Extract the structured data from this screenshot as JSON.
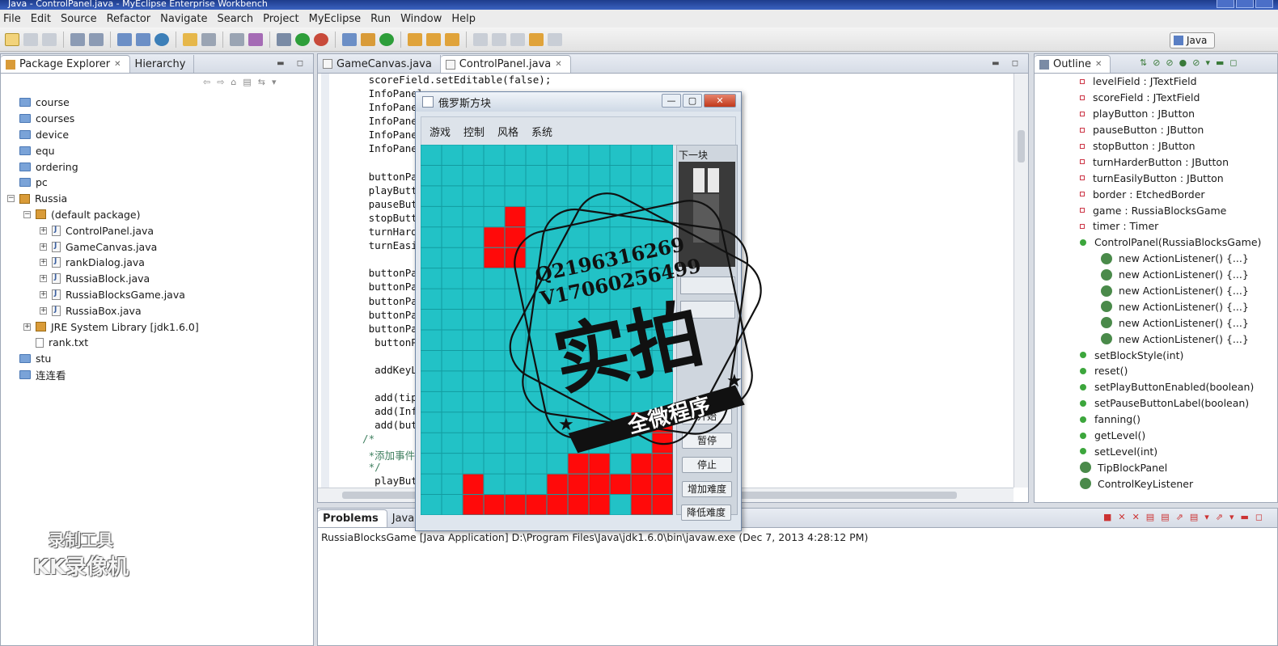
{
  "window": {
    "title": "Java - ControlPanel.java - MyEclipse Enterprise Workbench"
  },
  "menu": [
    "File",
    "Edit",
    "Source",
    "Refactor",
    "Navigate",
    "Search",
    "Project",
    "MyEclipse",
    "Run",
    "Window",
    "Help"
  ],
  "perspective": {
    "label": "Java"
  },
  "explorer": {
    "tabs": [
      "Package Explorer",
      "Hierarchy"
    ],
    "items": [
      {
        "label": "course",
        "type": "folder",
        "indent": 0
      },
      {
        "label": "courses",
        "type": "folder",
        "indent": 0
      },
      {
        "label": "device",
        "type": "folder",
        "indent": 0
      },
      {
        "label": "equ",
        "type": "folder",
        "indent": 0
      },
      {
        "label": "ordering",
        "type": "folder",
        "indent": 0
      },
      {
        "label": "pc",
        "type": "folder",
        "indent": 0
      },
      {
        "label": "Russia",
        "type": "project",
        "indent": 0
      },
      {
        "label": "(default package)",
        "type": "package",
        "indent": 1
      },
      {
        "label": "ControlPanel.java",
        "type": "java",
        "indent": 2
      },
      {
        "label": "GameCanvas.java",
        "type": "java",
        "indent": 2
      },
      {
        "label": "rankDialog.java",
        "type": "java",
        "indent": 2
      },
      {
        "label": "RussiaBlock.java",
        "type": "java",
        "indent": 2
      },
      {
        "label": "RussiaBlocksGame.java",
        "type": "java",
        "indent": 2
      },
      {
        "label": "RussiaBox.java",
        "type": "java",
        "indent": 2
      },
      {
        "label": "JRE System Library [jdk1.6.0]",
        "type": "library",
        "indent": 1
      },
      {
        "label": "rank.txt",
        "type": "text",
        "indent": 1
      },
      {
        "label": "stu",
        "type": "folder",
        "indent": 0
      },
      {
        "label": "连连看",
        "type": "folder",
        "indent": 0
      }
    ]
  },
  "editor": {
    "tabs": [
      "GameCanvas.java",
      "ControlPanel.java"
    ],
    "active_tab": "ControlPanel.java",
    "lines": [
      "   scoreField.setEditable(false);",
      "   InfoPanel",
      "   InfoPanel",
      "   InfoPanel",
      "   InfoPanel",
      "   InfoPanel",
      "",
      "   buttonPan",
      "   playButto",
      "   pauseButt",
      "   stopButto",
      "   turnHarde",
      "   turnEasil",
      "",
      "   buttonPan",
      "   buttonPan",
      "   buttonPan",
      "   buttonPan",
      "   buttonPan",
      "    buttonPan",
      "",
      "    addKeyLi",
      "",
      "    add(tipP",
      "    add(Info",
      "    add(butt",
      "  /*",
      "   *添加事件监",
      "   */",
      "    playButt"
    ]
  },
  "outline": {
    "tab": "Outline",
    "items": [
      {
        "label": "levelField : JTextField",
        "kind": "field",
        "indent": 0
      },
      {
        "label": "scoreField : JTextField",
        "kind": "field",
        "indent": 0
      },
      {
        "label": "playButton : JButton",
        "kind": "field",
        "indent": 0
      },
      {
        "label": "pauseButton : JButton",
        "kind": "field",
        "indent": 0
      },
      {
        "label": "stopButton : JButton",
        "kind": "field",
        "indent": 0
      },
      {
        "label": "turnHarderButton : JButton",
        "kind": "field",
        "indent": 0
      },
      {
        "label": "turnEasilyButton : JButton",
        "kind": "field",
        "indent": 0
      },
      {
        "label": "border : EtchedBorder",
        "kind": "field",
        "indent": 0
      },
      {
        "label": "game : RussiaBlocksGame",
        "kind": "field",
        "indent": 0
      },
      {
        "label": "timer : Timer",
        "kind": "field",
        "indent": 0
      },
      {
        "label": "ControlPanel(RussiaBlocksGame)",
        "kind": "ctor",
        "indent": 0
      },
      {
        "label": "new ActionListener() {...}",
        "kind": "anon",
        "indent": 1
      },
      {
        "label": "new ActionListener() {...}",
        "kind": "anon",
        "indent": 1
      },
      {
        "label": "new ActionListener() {...}",
        "kind": "anon",
        "indent": 1
      },
      {
        "label": "new ActionListener() {...}",
        "kind": "anon",
        "indent": 1
      },
      {
        "label": "new ActionListener() {...}",
        "kind": "anon",
        "indent": 1
      },
      {
        "label": "new ActionListener() {...}",
        "kind": "anon",
        "indent": 1
      },
      {
        "label": "setBlockStyle(int)",
        "kind": "method",
        "indent": 0
      },
      {
        "label": "reset()",
        "kind": "method",
        "indent": 0
      },
      {
        "label": "setPlayButtonEnabled(boolean)",
        "kind": "method",
        "indent": 0
      },
      {
        "label": "setPauseButtonLabel(boolean)",
        "kind": "method",
        "indent": 0
      },
      {
        "label": "fanning()",
        "kind": "method",
        "indent": 0
      },
      {
        "label": "getLevel()",
        "kind": "method",
        "indent": 0
      },
      {
        "label": "setLevel(int)",
        "kind": "method",
        "indent": 0
      },
      {
        "label": "TipBlockPanel",
        "kind": "class",
        "indent": 0
      },
      {
        "label": "ControlKeyListener",
        "kind": "class",
        "indent": 0
      }
    ]
  },
  "console": {
    "tabs": [
      "Problems",
      "Javadoc"
    ],
    "line": "RussiaBlocksGame [Java Application] D:\\Program Files\\Java\\jdk1.6.0\\bin\\javaw.exe (Dec 7, 2013 4:28:12 PM)"
  },
  "game": {
    "title": "俄罗斯方块",
    "menu": [
      "游戏",
      "控制",
      "风格",
      "系统"
    ],
    "next_label": "下一块",
    "buttons": [
      "开始",
      "暂停",
      "停止",
      "增加难度",
      "降低难度"
    ],
    "board": {
      "cols": 12,
      "rows": 18,
      "bg": "#22c2c6",
      "block": "#ff0a0a",
      "filled": [
        [
          4,
          3
        ],
        [
          3,
          4
        ],
        [
          4,
          4
        ],
        [
          3,
          5
        ],
        [
          4,
          5
        ],
        [
          10,
          13
        ],
        [
          11,
          13
        ],
        [
          11,
          14
        ],
        [
          7,
          15
        ],
        [
          8,
          15
        ],
        [
          10,
          15
        ],
        [
          11,
          15
        ],
        [
          11,
          16
        ],
        [
          2,
          16
        ],
        [
          6,
          16
        ],
        [
          7,
          16
        ],
        [
          8,
          16
        ],
        [
          9,
          16
        ],
        [
          10,
          16
        ],
        [
          2,
          17
        ],
        [
          3,
          17
        ],
        [
          4,
          17
        ],
        [
          5,
          17
        ],
        [
          6,
          17
        ],
        [
          7,
          17
        ],
        [
          8,
          17
        ],
        [
          10,
          17
        ],
        [
          11,
          17
        ]
      ]
    }
  },
  "watermarks": {
    "stamp_line1": "Q2196316269",
    "stamp_line2": "V17060256499",
    "stamp_big": "实拍",
    "stamp_banner": "全微程序",
    "recorder_line1": "录制工具",
    "recorder_line2": "KK录像机"
  },
  "colors": {
    "accent": "#3a62c0",
    "tetris_bg": "#22c2c6",
    "tetris_block": "#ff0a0a"
  }
}
